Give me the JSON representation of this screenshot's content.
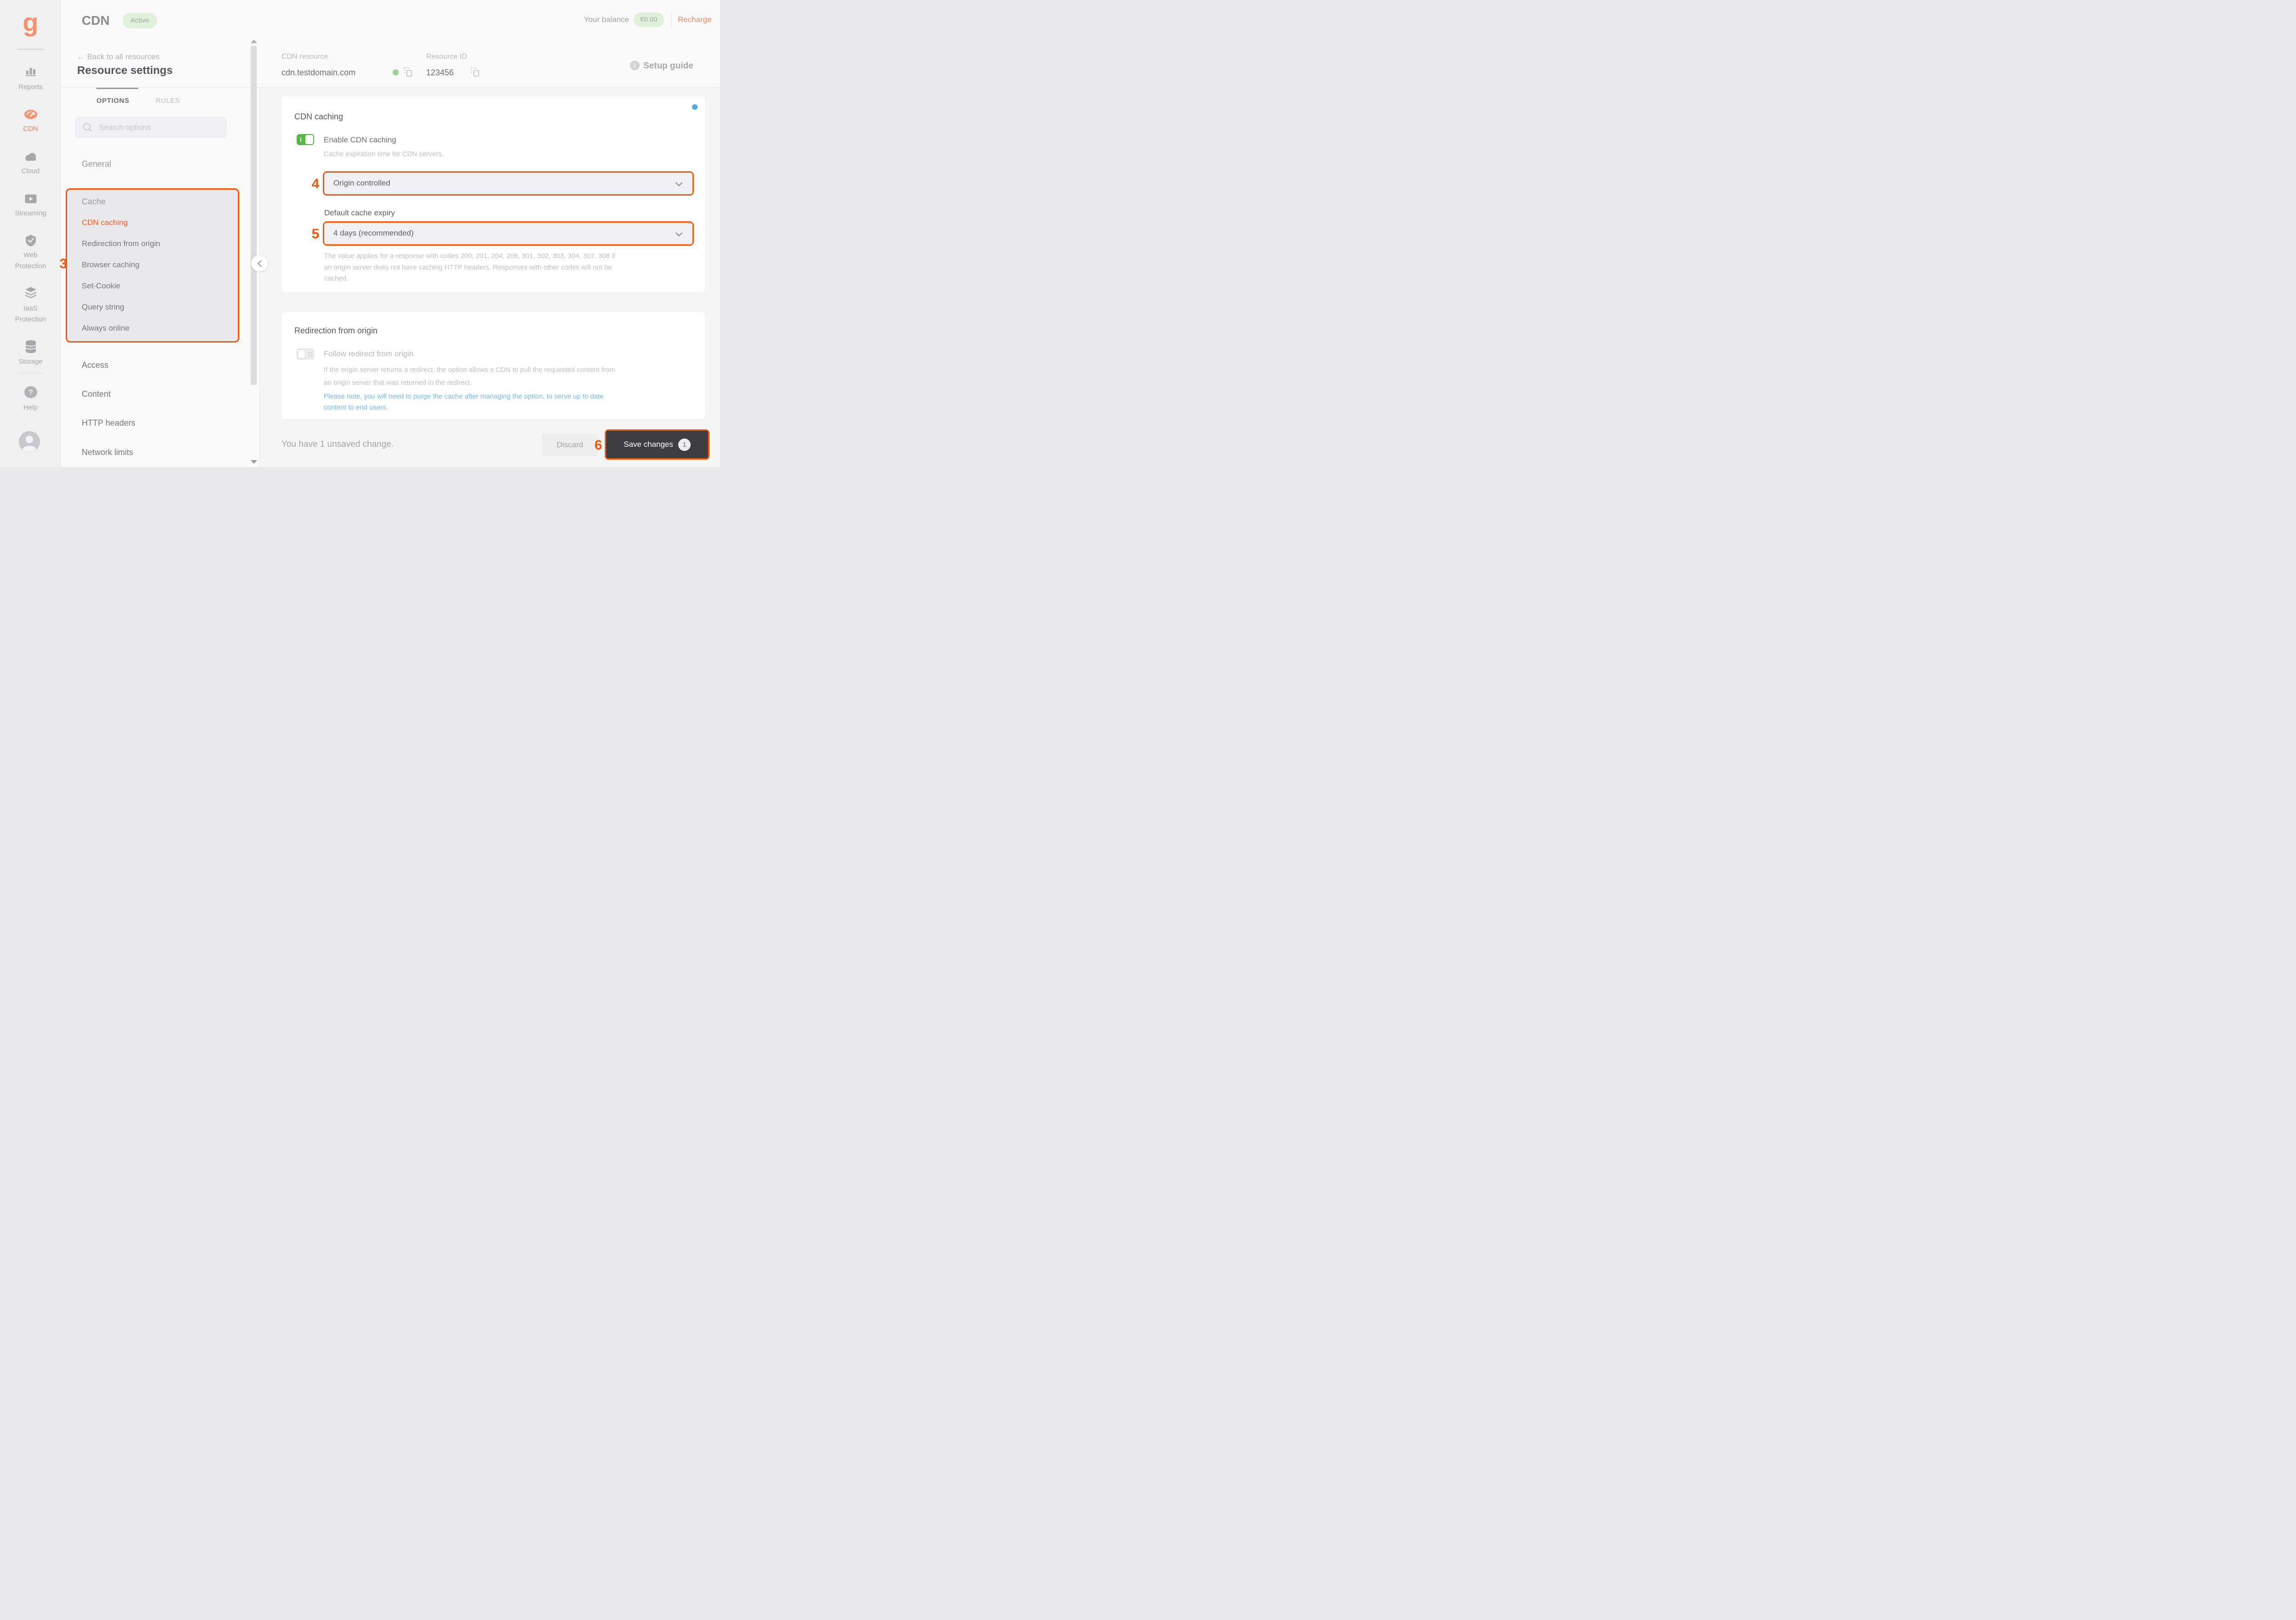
{
  "app": {
    "logo_letter": "g"
  },
  "colors": {
    "accent_orange": "#f4570a",
    "brand_salmon": "#f6916f",
    "menu_active_orange": "#fa5c1d",
    "toggle_green": "#57b54a",
    "status_green_bg": "#e1f0db",
    "status_dot_green": "#97d38c",
    "info_blue": "#48ade9",
    "link_blue": "#74bbf1"
  },
  "sidebar": {
    "items": [
      {
        "label": "Reports"
      },
      {
        "label": "CDN",
        "active": true
      },
      {
        "label": "Cloud"
      },
      {
        "label": "Streaming"
      },
      {
        "label": "Web\nProtection"
      },
      {
        "label": "IaaS\nProtection"
      },
      {
        "label": "Storage"
      },
      {
        "label": "Help"
      }
    ]
  },
  "topbar": {
    "title": "CDN",
    "status": "Active",
    "balance_label": "Your balance",
    "balance_value": "€0.00",
    "recharge_label": "Recharge"
  },
  "panel": {
    "back_link": "← Back to all resources",
    "title": "Resource settings",
    "tab_options": "OPTIONS",
    "tab_rules": "RULES",
    "search_placeholder": "Search options",
    "section_general": "General",
    "cache_group": {
      "heading": "Cache",
      "items": [
        "CDN caching",
        "Redirection from origin",
        "Browser caching",
        "Set-Cookie",
        "Query string",
        "Always online"
      ]
    },
    "more_items": [
      "Access",
      "Content",
      "HTTP headers",
      "Network limits"
    ]
  },
  "resource_header": {
    "resource_label": "CDN resource",
    "resource_value": "cdn.testdomain.com",
    "id_label": "Resource ID",
    "id_value": "123456",
    "setup_guide": "Setup guide"
  },
  "cdn_caching_card": {
    "title": "CDN caching",
    "toggle_label": "Enable CDN caching",
    "toggle_state": "on",
    "toggle_hint": "Cache expiration time for CDN servers.",
    "cache_method_value": "Origin controlled",
    "expiry_label": "Default cache expiry",
    "expiry_value": "4 days (recommended)",
    "expiry_hint": "The value applies for a response with codes 200, 201, 204, 206, 301, 302, 303, 304, 307, 308 if\nan origin server does not have caching HTTP headers. Responses with other codes will not be\ncached."
  },
  "redirection_card": {
    "title": "Redirection from origin",
    "toggle_label": "Follow redirect from origin",
    "toggle_state": "off",
    "hint": "If the origin server returns a redirect, the option allows a CDN to pull the requested content from\nan origin server that was returned in the redirect.",
    "note_link": "Please note, you will need to purge the cache after managing the option, to serve up to date\ncontent to end users."
  },
  "footer": {
    "status_text": "You have 1 unsaved change.",
    "discard_label": "Discard",
    "save_label": "Save changes",
    "save_badge": "1"
  },
  "annotations": {
    "step3": "3",
    "step4": "4",
    "step5": "5",
    "step6": "6"
  },
  "icons": {
    "info_glyph": "i",
    "help_glyph": "?"
  }
}
